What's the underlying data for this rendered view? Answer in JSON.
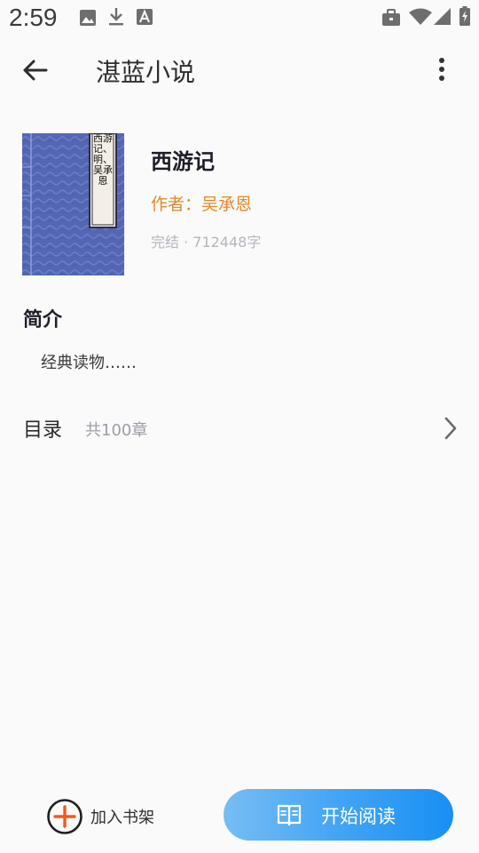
{
  "status_bar": {
    "time": "2:59",
    "left_icons": [
      "image-icon",
      "download-icon",
      "font-a-icon"
    ],
    "right_icons": [
      "briefcase-icon",
      "wifi-icon",
      "signal-icon",
      "battery-icon"
    ]
  },
  "app_bar": {
    "back_icon": "arrow-left-icon",
    "title": "湛蓝小说",
    "more_icon": "more-vertical-icon"
  },
  "book": {
    "cover_text": "西游记、明、吴承恩",
    "title": "西游记",
    "author": "作者：吴承恩",
    "meta": "完结 · 712448字"
  },
  "intro": {
    "heading": "简介",
    "text": "经典读物……"
  },
  "toc": {
    "label": "目录",
    "count": "共100章"
  },
  "bottom_bar": {
    "add_shelf_label": "加入书架",
    "start_reading_label": "开始阅读"
  },
  "colors": {
    "accent_blue": "#1890f3",
    "author_orange": "#e08a2c",
    "add_icon_orange": "#f25a1f",
    "cover_blue": "#5467b5"
  }
}
